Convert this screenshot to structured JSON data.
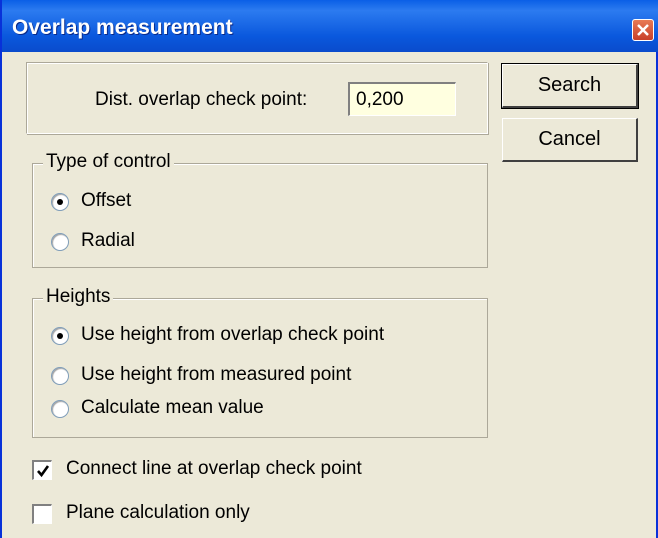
{
  "window": {
    "title": "Overlap measurement",
    "close_icon": "close-icon"
  },
  "distance": {
    "label": "Dist. overlap check point:",
    "value": "0,200"
  },
  "buttons": {
    "search": "Search",
    "cancel": "Cancel"
  },
  "type_of_control": {
    "legend": "Type of control",
    "options": [
      {
        "label": "Offset",
        "selected": true
      },
      {
        "label": "Radial",
        "selected": false
      }
    ]
  },
  "heights": {
    "legend": "Heights",
    "options": [
      {
        "label": "Use height from overlap check point",
        "selected": true
      },
      {
        "label": "Use height from measured point",
        "selected": false
      },
      {
        "label": "Calculate mean value",
        "selected": false
      }
    ]
  },
  "checkboxes": [
    {
      "label": "Connect line at overlap check point",
      "checked": true
    },
    {
      "label": "Plane calculation only",
      "checked": false
    }
  ]
}
